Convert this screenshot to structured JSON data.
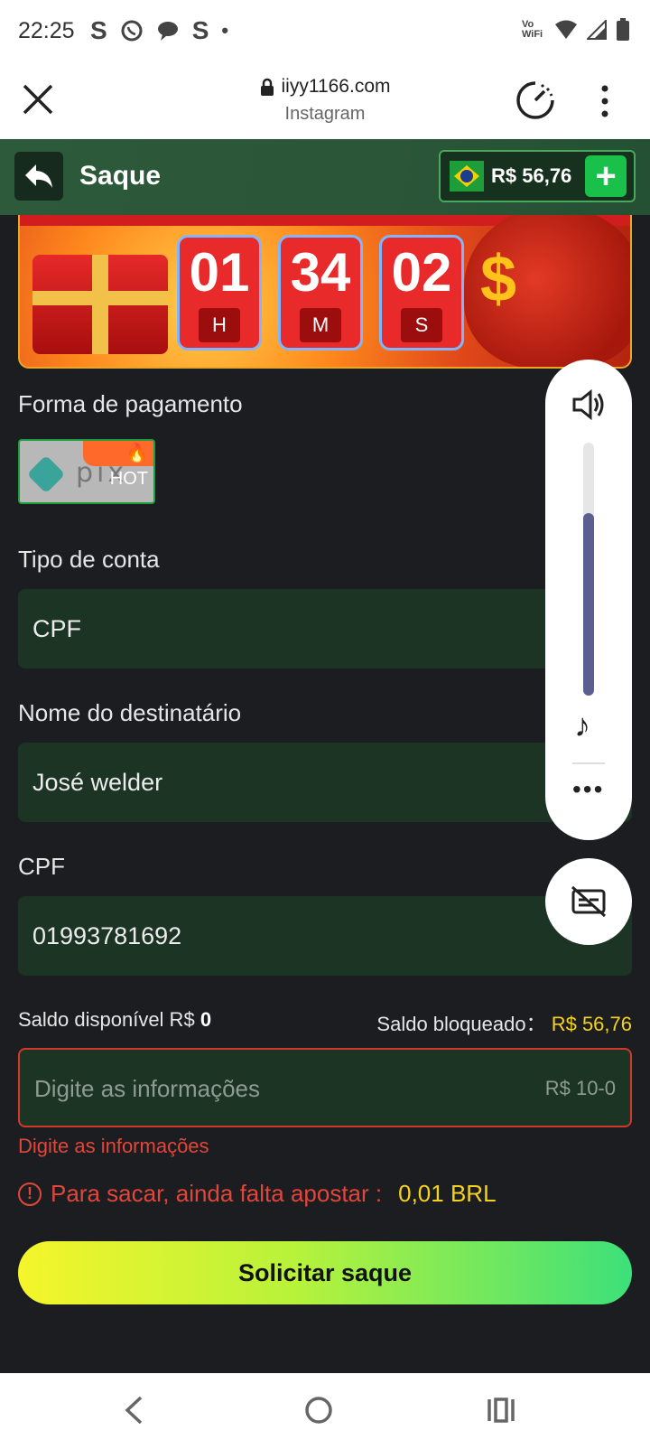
{
  "status_bar": {
    "time": "22:25",
    "left_icons": [
      "s-icon",
      "whatsapp-icon",
      "chat-bubble-icon",
      "s-icon",
      "dot-icon"
    ],
    "vowifi": "Vo WiFi"
  },
  "browser": {
    "url": "iiyy1166.com",
    "source": "Instagram"
  },
  "header": {
    "title": "Saque",
    "balance": "R$ 56,76"
  },
  "countdown": {
    "hours": "01",
    "minutes": "34",
    "seconds": "02",
    "hours_unit": "H",
    "minutes_unit": "M",
    "seconds_unit": "S"
  },
  "form": {
    "payment_label": "Forma de pagamento",
    "pix_badge": "HOT",
    "pix_text": "pix",
    "account_type_label": "Tipo de conta",
    "account_type_value": "CPF",
    "recipient_label": "Nome do destinatário",
    "recipient_value": "José welder",
    "cpf_label": "CPF",
    "cpf_value": "01993781692",
    "available_label": "Saldo disponível R$",
    "available_value": "0",
    "blocked_label": "Saldo bloqueado：",
    "blocked_value": "R$ 56,76",
    "amount_placeholder": "Digite as informações",
    "amount_range": "R$ 10-0",
    "error_text": "Digite as informações",
    "warning_text": "Para sacar, ainda falta apostar :",
    "warning_value": "0,01 BRL",
    "submit_label": "Solicitar saque"
  },
  "volume_panel": {
    "level": 0.72
  },
  "colors": {
    "background": "#1c1d21",
    "field": "#1c3424",
    "header": "#2b5638",
    "accent_yellow": "#f5d21c",
    "error_red": "#e2463a",
    "green": "#19c04a"
  }
}
